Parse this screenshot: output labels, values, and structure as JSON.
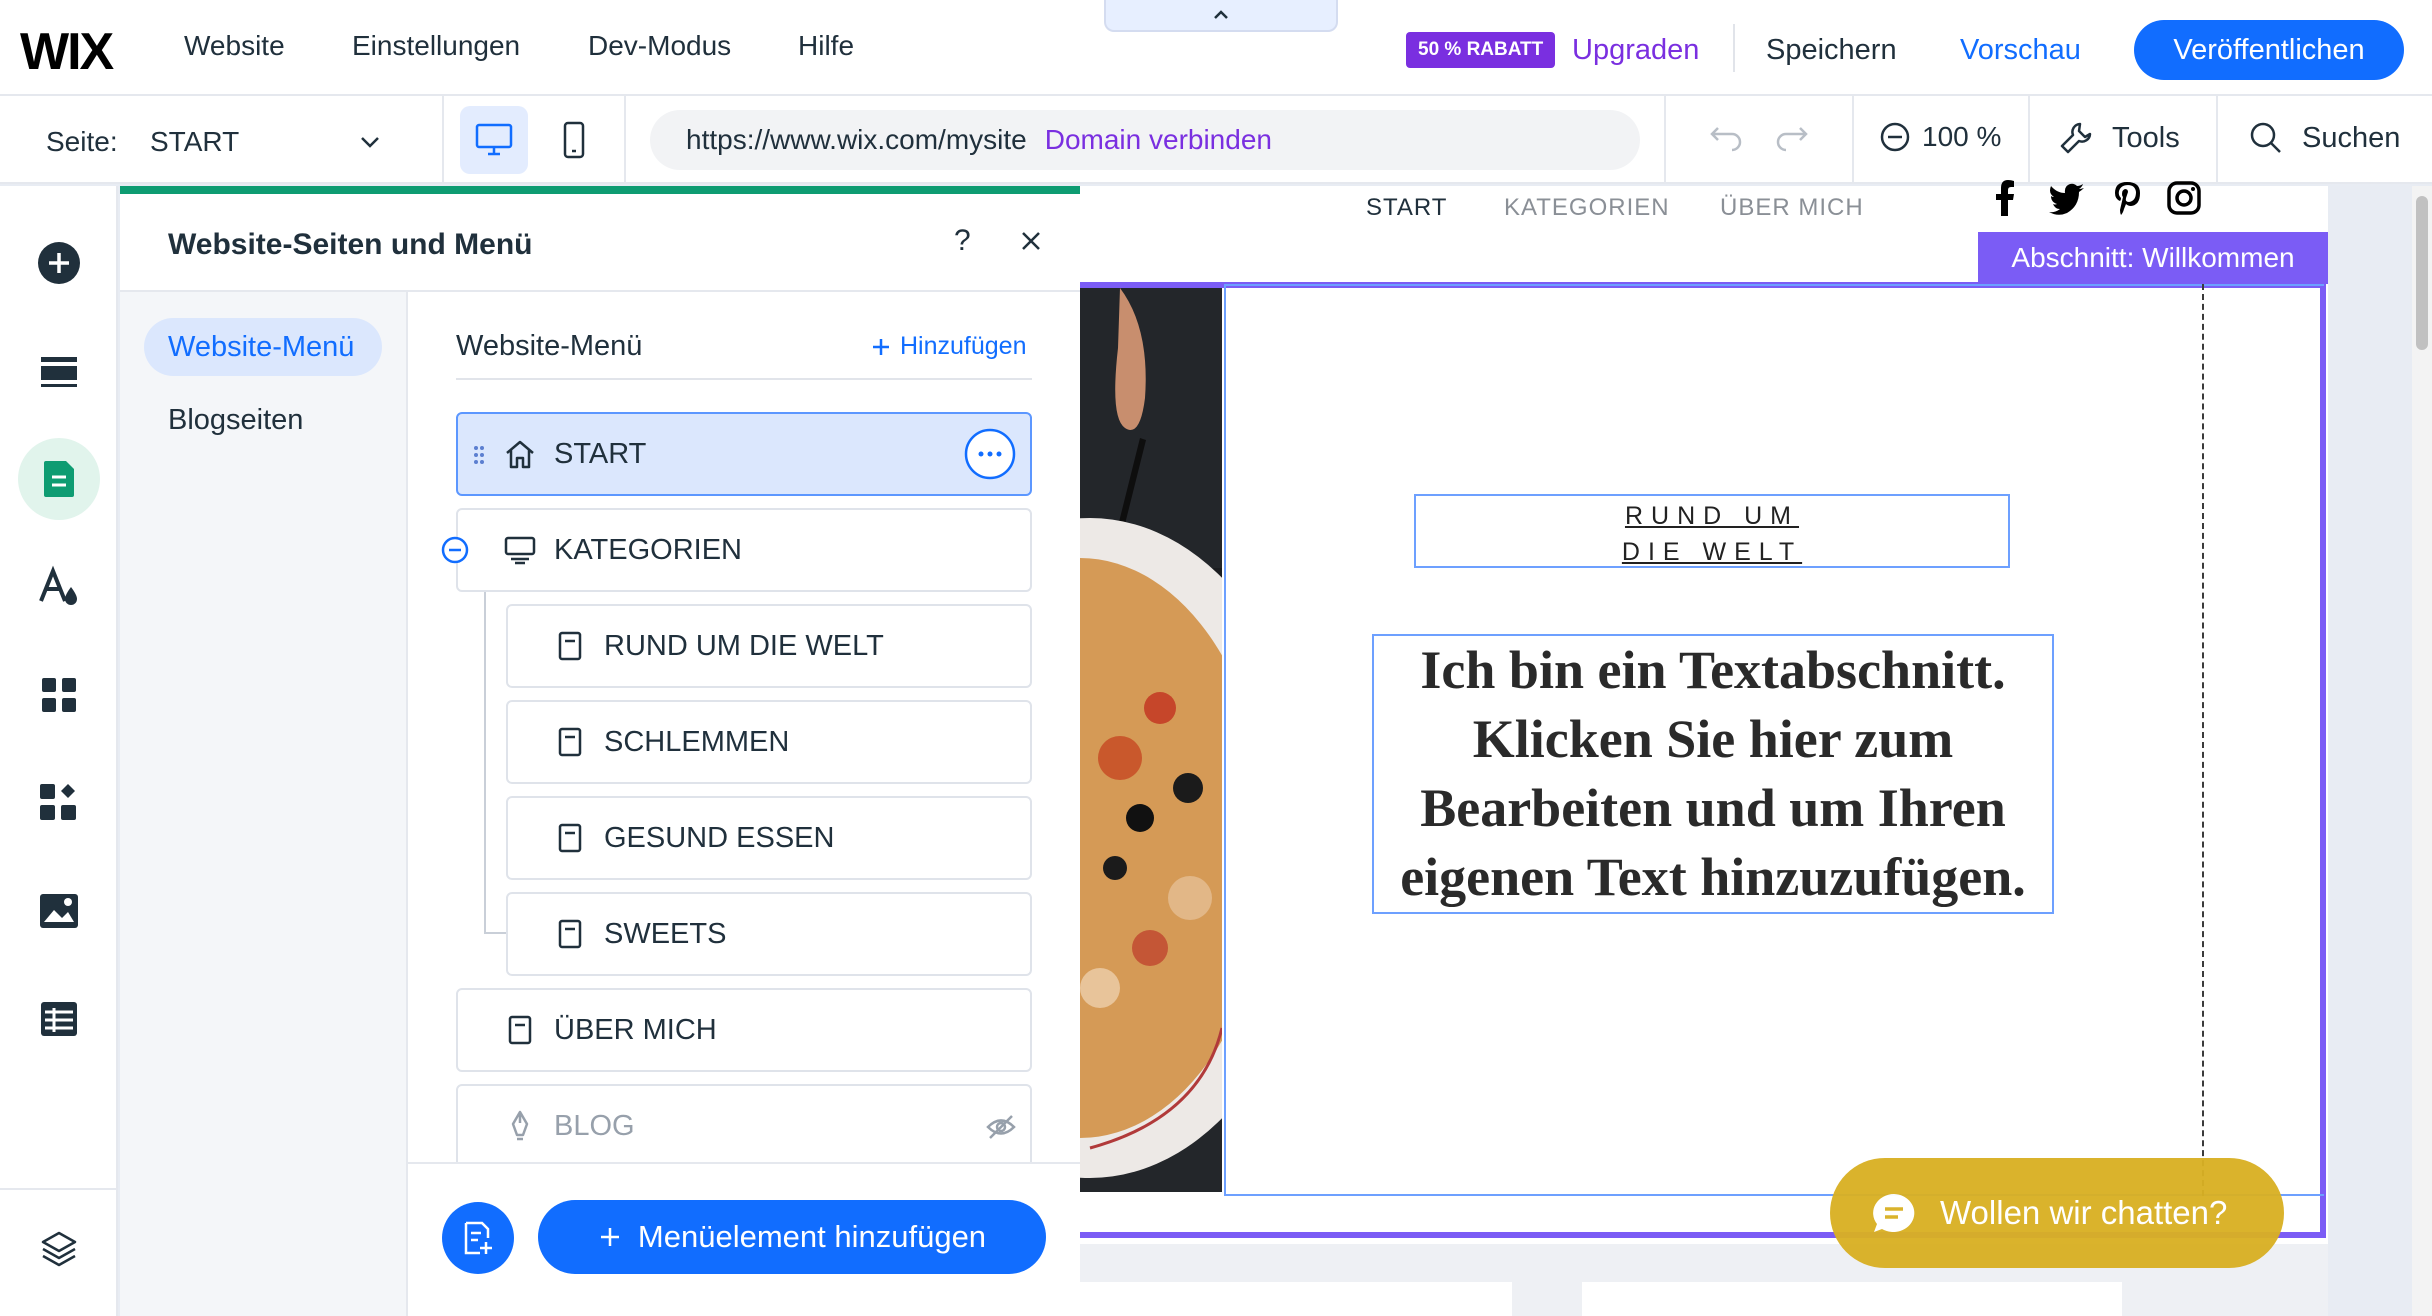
{
  "topbar": {
    "logo": "WIX",
    "menu": [
      "Website",
      "Einstellungen",
      "Dev-Modus",
      "Hilfe"
    ],
    "discount_badge": "50 % RABATT",
    "upgrade": "Upgraden",
    "save": "Speichern",
    "preview": "Vorschau",
    "publish": "Veröffentlichen",
    "accent_color": "#116dff",
    "upgrade_color": "#7a2fe0"
  },
  "toolbar": {
    "page_label": "Seite:",
    "page_value": "START",
    "url": "https://www.wix.com/mysite",
    "connect_domain": "Domain verbinden",
    "zoom": "100 %",
    "tools": "Tools",
    "search": "Suchen"
  },
  "panel": {
    "title": "Website-Seiten und Menü",
    "help": "?",
    "nav": {
      "website_menu": "Website-Menü",
      "blog_pages": "Blogseiten"
    },
    "list_heading": "Website-Menü",
    "add_link": "Hinzufügen",
    "items": [
      {
        "label": "START",
        "icon": "home-icon",
        "selected": true
      },
      {
        "label": "KATEGORIEN",
        "icon": "folder-menu-icon",
        "expanded": true
      },
      {
        "label": "RUND UM DIE WELT",
        "icon": "page-icon",
        "child": true
      },
      {
        "label": "SCHLEMMEN",
        "icon": "page-icon",
        "child": true
      },
      {
        "label": "GESUND ESSEN",
        "icon": "page-icon",
        "child": true
      },
      {
        "label": "SWEETS",
        "icon": "page-icon",
        "child": true
      },
      {
        "label": "ÜBER MICH",
        "icon": "page-icon"
      },
      {
        "label": "BLOG",
        "icon": "pen-icon",
        "hidden": true
      }
    ],
    "add_menu_item": "Menüelement hinzufügen"
  },
  "canvas": {
    "site_nav": [
      "START",
      "KATEGORIEN",
      "ÜBER MICH"
    ],
    "section_badge": "Abschnitt: Willkommen",
    "section_color": "#7b5cf5",
    "title_lines": [
      "RUND UM",
      "DIE WELT"
    ],
    "body_lines": [
      "Ich bin ein Textabschnitt.",
      "Klicken Sie hier zum",
      "Bearbeiten und um Ihren",
      "eigenen Text hinzuzufügen."
    ],
    "chat": "Wollen wir chatten?"
  }
}
